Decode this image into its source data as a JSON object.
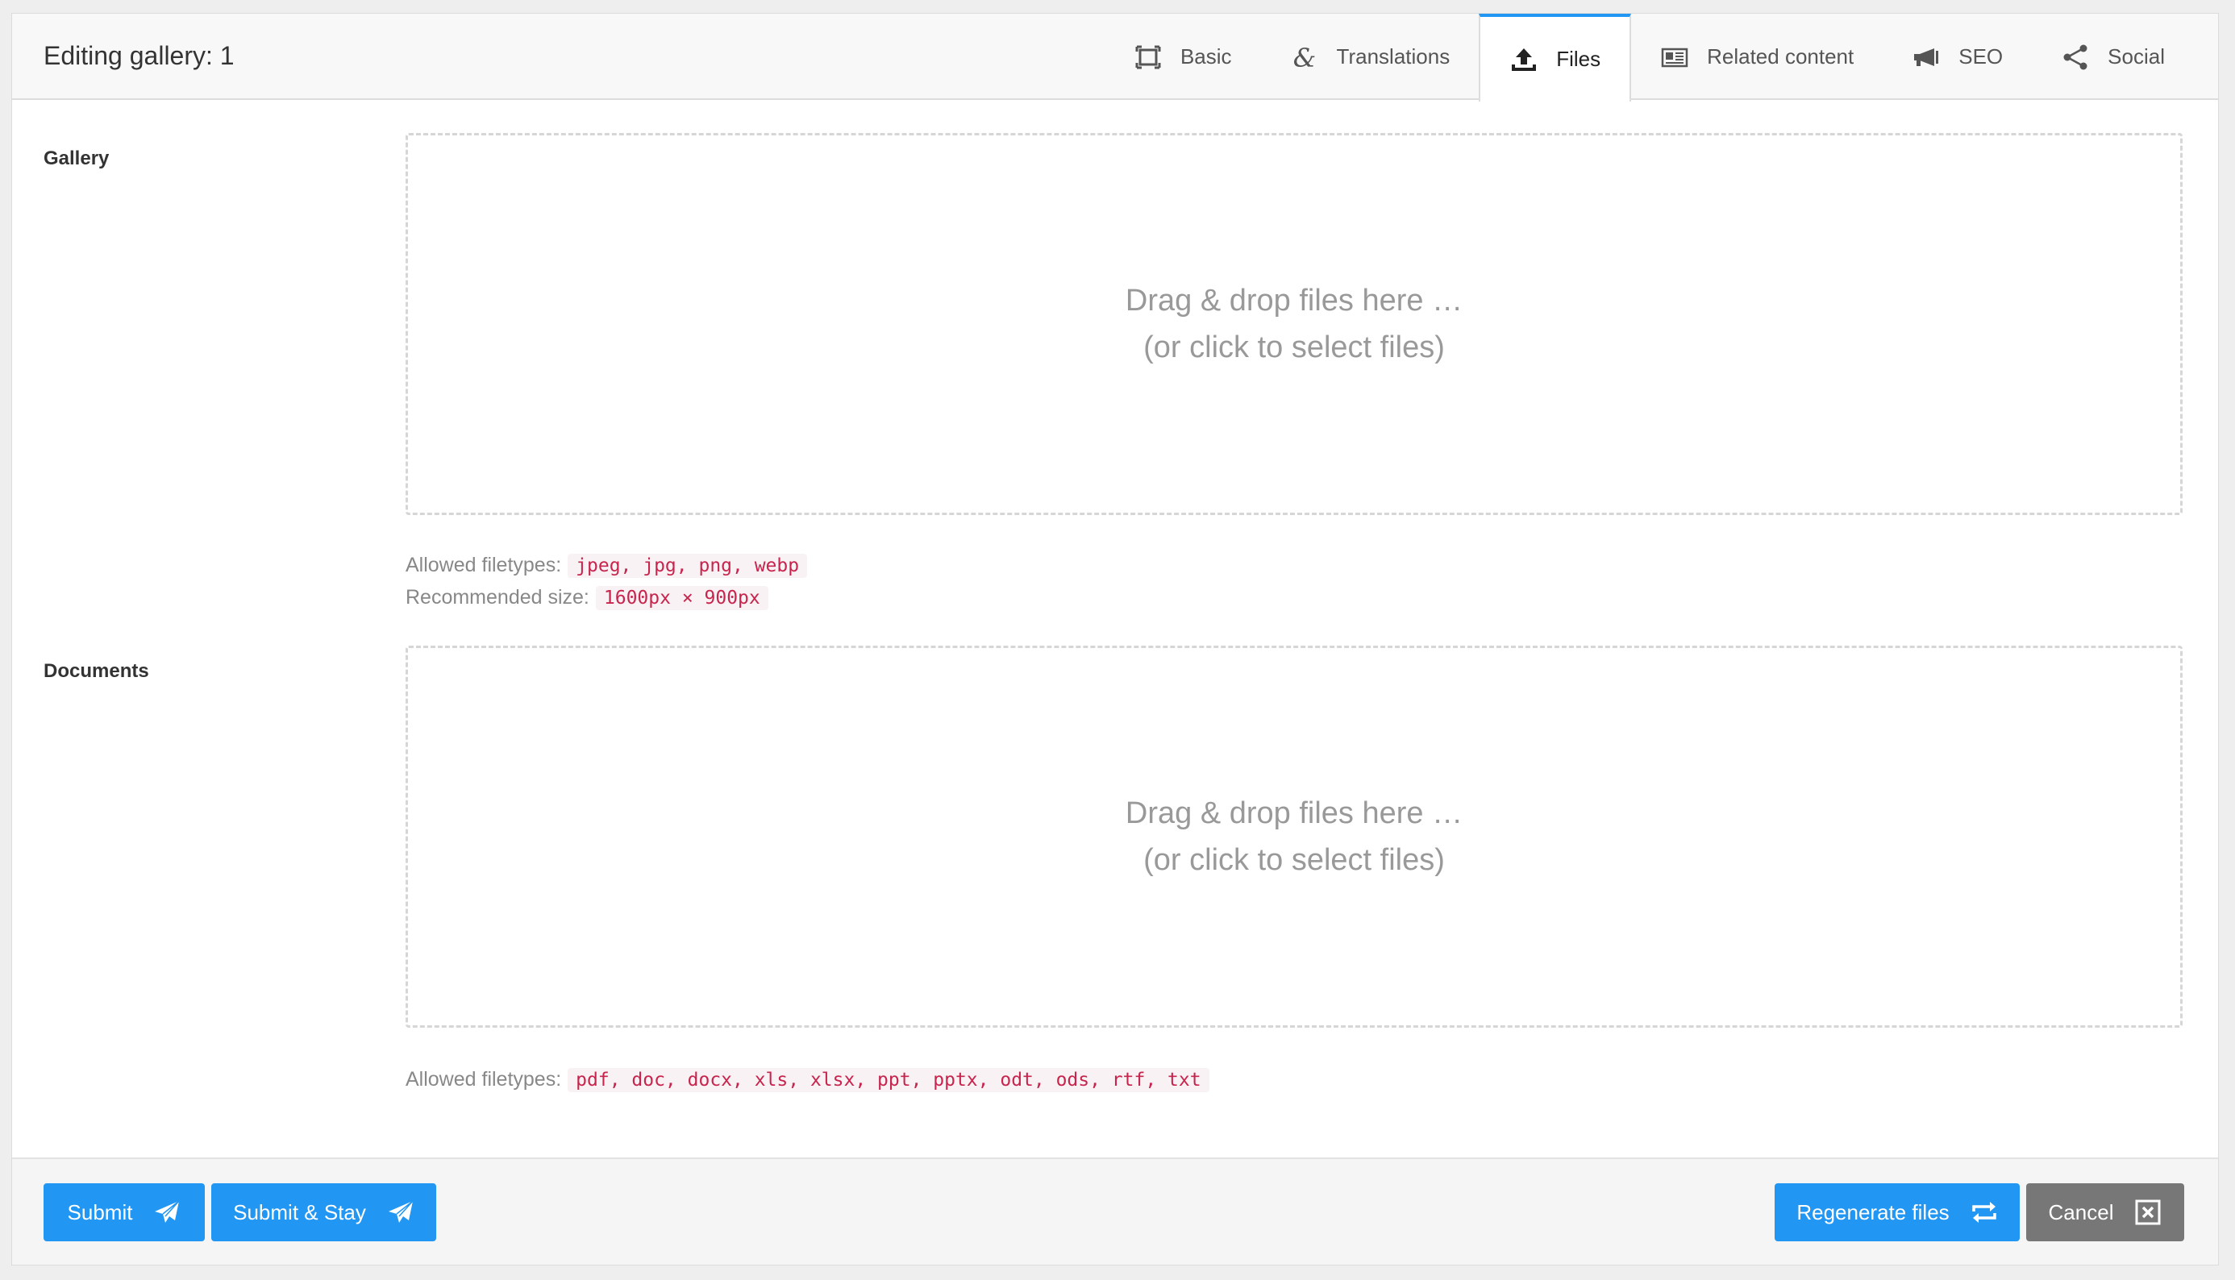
{
  "header": {
    "title": "Editing gallery: 1",
    "tabs": [
      {
        "label": "Basic",
        "icon": "frame-icon"
      },
      {
        "label": "Translations",
        "icon": "ampersand-icon"
      },
      {
        "label": "Files",
        "icon": "upload-icon",
        "active": true
      },
      {
        "label": "Related content",
        "icon": "newspaper-icon"
      },
      {
        "label": "SEO",
        "icon": "megaphone-icon"
      },
      {
        "label": "Social",
        "icon": "share-icon"
      }
    ],
    "active_tab_color": "#2196f3"
  },
  "gallery": {
    "label": "Gallery",
    "dropzone_line1": "Drag & drop files here …",
    "dropzone_line2": "(or click to select files)",
    "allowed_label": "Allowed filetypes:",
    "allowed_value": "jpeg, jpg, png, webp",
    "size_label": "Recommended size:",
    "size_value": "1600px × 900px"
  },
  "documents": {
    "label": "Documents",
    "dropzone_line1": "Drag & drop files here …",
    "dropzone_line2": "(or click to select files)",
    "allowed_label": "Allowed filetypes:",
    "allowed_value": "pdf, doc, docx, xls, xlsx, ppt, pptx, odt, ods, rtf, txt"
  },
  "footer": {
    "submit_label": "Submit",
    "submit_stay_label": "Submit & Stay",
    "regenerate_label": "Regenerate files",
    "cancel_label": "Cancel",
    "primary_color": "#2196f3",
    "secondary_color": "#777777"
  }
}
